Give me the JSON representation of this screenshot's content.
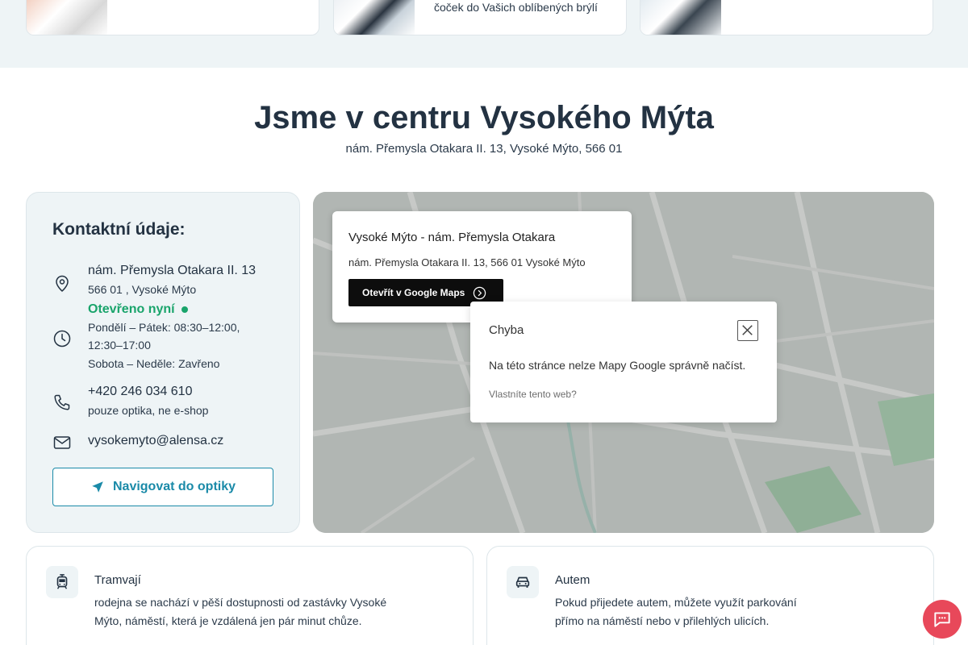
{
  "top_cards": [
    {
      "caption": ""
    },
    {
      "caption": "čoček do Vašich oblíbených brýlí"
    },
    {
      "caption": ""
    }
  ],
  "location": {
    "heading": "Jsme v centru Vysokého Mýta",
    "address": "nám. Přemysla Otakara II. 13, Vysoké Mýto, 566 01"
  },
  "contact": {
    "title": "Kontaktní údaje:",
    "street": "nám. Přemysla Otakara II. 13",
    "city": "566 01 , Vysoké Mýto",
    "open_status": "Otevřeno nyní",
    "hours_weekdays": "Pondělí – Pátek: 08:30–12:00, 12:30–17:00",
    "hours_weekend": "Sobota – Neděle: Zavřeno",
    "phone": "+420 246 034 610",
    "phone_note": "pouze optika, ne e-shop",
    "email": "vysokemyto@alensa.cz",
    "navigate_label": "Navigovat do optiky"
  },
  "map": {
    "info_title": "Vysoké Mýto - nám. Přemysla Otakara",
    "info_address": "nám. Přemysla Otakara II. 13, 566 01 Vysoké Mýto",
    "open_maps_label": "Otevřít v Google Maps",
    "error_title": "Chyba",
    "error_message": "Na této stránce nelze Mapy Google správně načíst.",
    "error_link": "Vlastníte tento web?"
  },
  "transport": [
    {
      "title": "Tramvají",
      "text": "rodejna se nachází v pěší dostupnosti od zastávky Vysoké Mýto, náměstí, která je vzdálená jen pár minut chůze.",
      "icon": "tram-icon"
    },
    {
      "title": "Autem",
      "text": "Pokud přijedete autem, můžete využít parkování přímo na náměstí nebo v přilehlých ulicích.",
      "icon": "car-icon"
    }
  ],
  "colors": {
    "accent": "#1a8aa8",
    "open": "#19a46b",
    "chat": "#e8485a",
    "panel": "#eef4f6"
  }
}
